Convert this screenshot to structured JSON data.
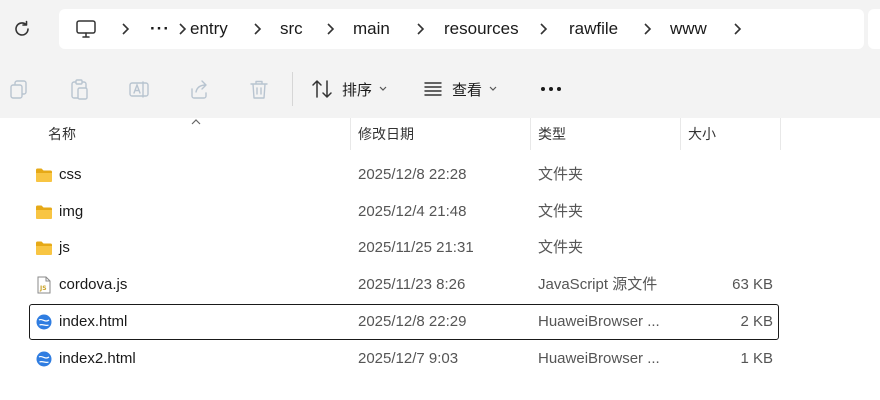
{
  "address_bar": {
    "overflow": "···",
    "crumbs": [
      "entry",
      "src",
      "main",
      "resources",
      "rawfile",
      "www"
    ]
  },
  "toolbar": {
    "sort_label": "排序",
    "view_label": "查看",
    "more": "···"
  },
  "columns": {
    "name": "名称",
    "modified": "修改日期",
    "type": "类型",
    "size": "大小"
  },
  "files": [
    {
      "icon": "folder-icon",
      "name": "css",
      "modified": "2025/12/8 22:28",
      "type": "文件夹",
      "size": ""
    },
    {
      "icon": "folder-icon",
      "name": "img",
      "modified": "2025/12/4 21:48",
      "type": "文件夹",
      "size": ""
    },
    {
      "icon": "folder-icon",
      "name": "js",
      "modified": "2025/11/25 21:31",
      "type": "文件夹",
      "size": ""
    },
    {
      "icon": "js-file-icon",
      "name": "cordova.js",
      "modified": "2025/11/23 8:26",
      "type": "JavaScript 源文件",
      "size": "63 KB"
    },
    {
      "icon": "html-file-icon",
      "name": "index.html",
      "modified": "2025/12/8 22:29",
      "type": "HuaweiBrowser ...",
      "size": "2 KB",
      "selected": true
    },
    {
      "icon": "html-file-icon",
      "name": "index2.html",
      "modified": "2025/12/7 9:03",
      "type": "HuaweiBrowser ...",
      "size": "1 KB"
    }
  ],
  "colors": {
    "folder": "#f8c543",
    "folder_dark": "#e6a917",
    "html_icon": "#2f7de1",
    "js_icon": "#c9a227"
  }
}
